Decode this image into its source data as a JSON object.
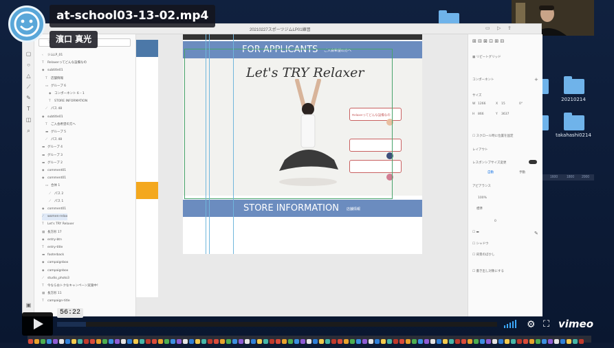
{
  "video": {
    "title": "at-school03-13-02.mp4",
    "presenter": "濱口 真光",
    "current_time": "56:22",
    "progress": 0.065,
    "brand": "vimeo"
  },
  "app": {
    "document_title": "20210227スポーツジムLP01練習"
  },
  "layers": {
    "search_placeholder": "すべてのアセットを検索",
    "items": [
      {
        "icon": "‹",
        "label": "ジムLP_01"
      },
      {
        "icon": "T",
        "label": "Relaxerってどんな設備なの"
      },
      {
        "icon": "◆",
        "label": "subtitle01"
      },
      {
        "icon": "T",
        "label": "店舗情報"
      },
      {
        "icon": "▭",
        "label": "グループ 6"
      },
      {
        "icon": "◆",
        "label": "コンポーネント 6 – 1"
      },
      {
        "icon": "T",
        "label": "STORE INFORMATION"
      },
      {
        "icon": "⟋",
        "label": "パス 48"
      },
      {
        "icon": "◆",
        "label": "subtitle01"
      },
      {
        "icon": "T",
        "label": "ご入会希望の方へ"
      },
      {
        "icon": "▬",
        "label": "グループ 5"
      },
      {
        "icon": "⟋",
        "label": "パス 48"
      },
      {
        "icon": "▬",
        "label": "グループ 4"
      },
      {
        "icon": "▬",
        "label": "グループ 3"
      },
      {
        "icon": "▬",
        "label": "グループ 2"
      },
      {
        "icon": "◆",
        "label": "comment01"
      },
      {
        "icon": "◆",
        "label": "comment01"
      },
      {
        "icon": "▭",
        "label": "合体 1"
      },
      {
        "icon": "⟋",
        "label": "パス 2"
      },
      {
        "icon": "⟋",
        "label": "パス 1"
      },
      {
        "icon": "◆",
        "label": "comment01"
      },
      {
        "icon": "⟋",
        "label": "women-relax"
      },
      {
        "icon": "T",
        "label": "Let's TRY Relaxer"
      },
      {
        "icon": "▦",
        "label": "長方形 17"
      },
      {
        "icon": "◆",
        "label": "entry-btn"
      },
      {
        "icon": "T",
        "label": "entry-title"
      },
      {
        "icon": "▬",
        "label": "footerback"
      },
      {
        "icon": "◆",
        "label": "campaignbox"
      },
      {
        "icon": "◆",
        "label": "campaignbox"
      },
      {
        "icon": "⟋",
        "label": "studio_photo3"
      },
      {
        "icon": "T",
        "label": "今ならおトクなキャンペーン実施中！"
      },
      {
        "icon": "▦",
        "label": "長方形 11"
      },
      {
        "icon": "T",
        "label": "campaign-title"
      }
    ]
  },
  "artboard": {
    "banner": "FOR APPLICANTS",
    "banner_sub": "ご入会希望の方へ",
    "headline": "Let's TRY Relaxer",
    "bubble1": "Relaxerってどんな設備なの",
    "store_banner": "STORE INFORMATION",
    "store_sub": "店舗情報"
  },
  "properties": {
    "repeat_grid": "リピートグリッド",
    "component": "コンポーネント",
    "size_label": "サイズ",
    "w_label": "W",
    "w": "1266",
    "x_label": "X",
    "x": "15",
    "rotation": "0°",
    "h_label": "H",
    "h": "866",
    "y_label": "Y",
    "y": "3637",
    "fix_scroll": "スクロール時に位置を固定",
    "layout": "レイアウト",
    "responsive": "レスポンシブサイズ変更",
    "auto": "自動",
    "manual": "手動",
    "appearance": "アピアランス",
    "opacity": "100%",
    "blend": "標準",
    "radius": "0",
    "shadow": "シャドウ",
    "bg_blur": "背景のぼかし",
    "export_mark": "書き出し対象にする"
  },
  "desktop": {
    "folders": [
      "20210214",
      "takahashi0214"
    ],
    "ruler": [
      "1600",
      "1800",
      "2000"
    ]
  }
}
